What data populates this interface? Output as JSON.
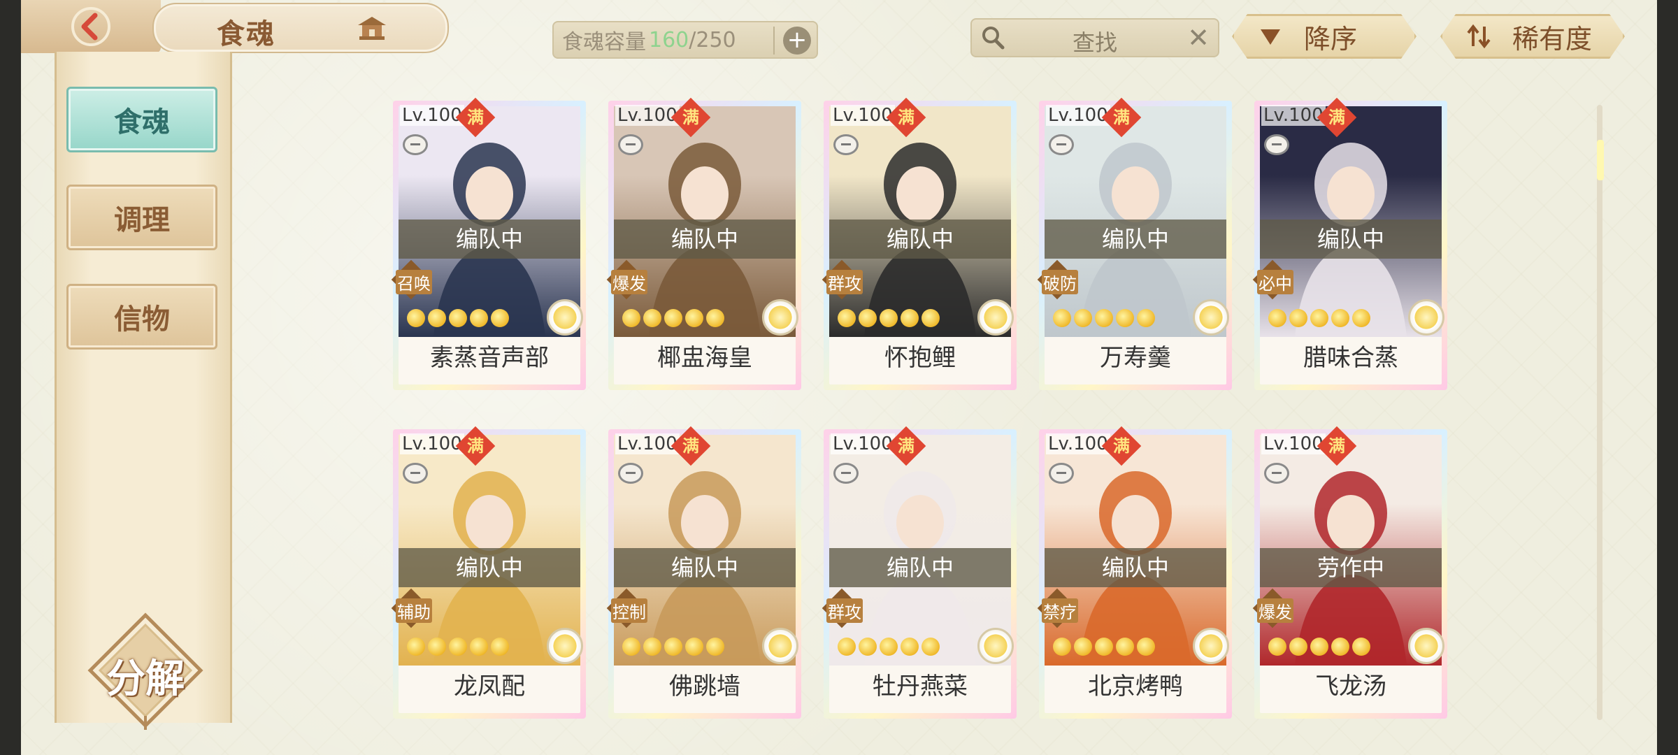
{
  "header": {
    "title": "食魂",
    "capacity_label": "食魂容量",
    "capacity_current": "160",
    "capacity_max": "/250",
    "search_label": "查找",
    "sort_order_label": "降序",
    "sort_field_label": "稀有度"
  },
  "sidebar": {
    "tabs": [
      "食魂",
      "调理",
      "信物"
    ],
    "decompose_label": "分解"
  },
  "colors": {
    "accent_green": "#8ed38e",
    "active_tab": "#96d6c9",
    "badge_red": "#e04632"
  },
  "cards": [
    {
      "level": "Lv.100",
      "full": "满",
      "status": "编队中",
      "role": "召唤",
      "name": "素蒸音声部",
      "stars": 5
    },
    {
      "level": "Lv.100",
      "full": "满",
      "status": "编队中",
      "role": "爆发",
      "name": "椰盅海皇",
      "stars": 5
    },
    {
      "level": "Lv.100",
      "full": "满",
      "status": "编队中",
      "role": "群攻",
      "name": "怀抱鲤",
      "stars": 5
    },
    {
      "level": "Lv.100",
      "full": "满",
      "status": "编队中",
      "role": "破防",
      "name": "万寿羹",
      "stars": 5
    },
    {
      "level": "Lv.100",
      "full": "满",
      "status": "编队中",
      "role": "必中",
      "name": "腊味合蒸",
      "stars": 5
    },
    {
      "level": "Lv.100",
      "full": "满",
      "status": "编队中",
      "role": "辅助",
      "name": "龙凤配",
      "stars": 5
    },
    {
      "level": "Lv.100",
      "full": "满",
      "status": "编队中",
      "role": "控制",
      "name": "佛跳墙",
      "stars": 5
    },
    {
      "level": "Lv.100",
      "full": "满",
      "status": "编队中",
      "role": "群攻",
      "name": "牡丹燕菜",
      "stars": 5
    },
    {
      "level": "Lv.100",
      "full": "满",
      "status": "编队中",
      "role": "禁疗",
      "name": "北京烤鸭",
      "stars": 5
    },
    {
      "level": "Lv.100",
      "full": "满",
      "status": "劳作中",
      "role": "爆发",
      "name": "飞龙汤",
      "stars": 5
    }
  ],
  "card_portraits": [
    [
      "#ece7f2",
      "#2a3550"
    ],
    [
      "#d8c6b6",
      "#7a5a3a"
    ],
    [
      "#f1e6c8",
      "#2b2b2b"
    ],
    [
      "#dfe7e6",
      "#bfc7cc"
    ],
    [
      "#2a2b45",
      "#e8e2e9"
    ],
    [
      "#f7e9c8",
      "#e2b24f"
    ],
    [
      "#f5e6ce",
      "#c89a5b"
    ],
    [
      "#f3ede5",
      "#efe9ea"
    ],
    [
      "#f7e6d6",
      "#d9692b"
    ],
    [
      "#f4ebe4",
      "#b0272b"
    ]
  ]
}
